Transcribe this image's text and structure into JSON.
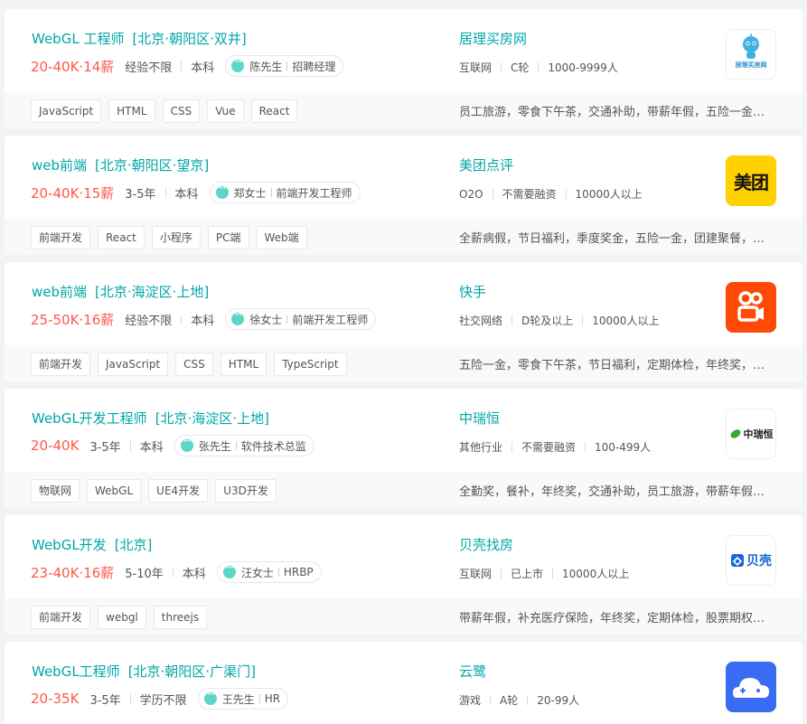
{
  "jobs": [
    {
      "title": "WebGL 工程师",
      "location": "[北京·朝阳区·双井]",
      "salary": "20-40K·14薪",
      "experience": "经验不限",
      "education": "本科",
      "recruiter_name": "陈先生",
      "recruiter_title": "招聘经理",
      "company": "居理买房网",
      "industry": "互联网",
      "stage": "C轮",
      "size": "1000-9999人",
      "logo_text": "居理买房网",
      "logo_icon": "robot-mascot-icon",
      "tags": [
        "JavaScript",
        "HTML",
        "CSS",
        "Vue",
        "React"
      ],
      "benefits": "员工旅游，零食下午茶，交通补助，带薪年假，五险一金…"
    },
    {
      "title": "web前端",
      "location": "[北京·朝阳区·望京]",
      "salary": "20-40K·15薪",
      "experience": "3-5年",
      "education": "本科",
      "recruiter_name": "郑女士",
      "recruiter_title": "前端开发工程师",
      "company": "美团点评",
      "industry": "O2O",
      "stage": "不需要融资",
      "size": "10000人以上",
      "logo_text": "美团",
      "logo_icon": "meituan-logo",
      "tags": [
        "前端开发",
        "React",
        "小程序",
        "PC端",
        "Web端"
      ],
      "benefits": "全薪病假，节日福利，季度奖金，五险一金，团建聚餐，…"
    },
    {
      "title": "web前端",
      "location": "[北京·海淀区·上地]",
      "salary": "25-50K·16薪",
      "experience": "经验不限",
      "education": "本科",
      "recruiter_name": "徐女士",
      "recruiter_title": "前端开发工程师",
      "company": "快手",
      "industry": "社交网络",
      "stage": "D轮及以上",
      "size": "10000人以上",
      "logo_text": "",
      "logo_icon": "kuaishou-camera-icon",
      "tags": [
        "前端开发",
        "JavaScript",
        "CSS",
        "HTML",
        "TypeScript"
      ],
      "benefits": "五险一金，零食下午茶，节日福利，定期体检，年终奖，…"
    },
    {
      "title": "WebGL开发工程师",
      "location": "[北京·海淀区·上地]",
      "salary": "20-40K",
      "experience": "3-5年",
      "education": "本科",
      "recruiter_name": "张先生",
      "recruiter_title": "软件技术总监",
      "company": "中瑞恒",
      "industry": "其他行业",
      "stage": "不需要融资",
      "size": "100-499人",
      "logo_text": "中瑞恒",
      "logo_icon": "leaf-icon",
      "tags": [
        "物联网",
        "WebGL",
        "UE4开发",
        "U3D开发"
      ],
      "benefits": "全勤奖，餐补，年终奖，交通补助，员工旅游，带薪年假…"
    },
    {
      "title": "WebGL开发",
      "location": "[北京]",
      "salary": "23-40K·16薪",
      "experience": "5-10年",
      "education": "本科",
      "recruiter_name": "汪女士",
      "recruiter_title": "HRBP",
      "company": "贝壳找房",
      "industry": "互联网",
      "stage": "已上市",
      "size": "10000人以上",
      "logo_text": "贝壳",
      "logo_icon": "beike-house-icon",
      "tags": [
        "前端开发",
        "webgl",
        "threejs"
      ],
      "benefits": "带薪年假，补充医疗保险，年终奖，定期体检，股票期权…"
    },
    {
      "title": "WebGL工程师",
      "location": "[北京·朝阳区·广渠门]",
      "salary": "20-35K",
      "experience": "3-5年",
      "education": "学历不限",
      "recruiter_name": "王先生",
      "recruiter_title": "HR",
      "company": "云鹭",
      "industry": "游戏",
      "stage": "A轮",
      "size": "20-99人",
      "logo_text": "",
      "logo_icon": "cloud-gamepad-icon",
      "tags": [],
      "benefits": ""
    }
  ]
}
